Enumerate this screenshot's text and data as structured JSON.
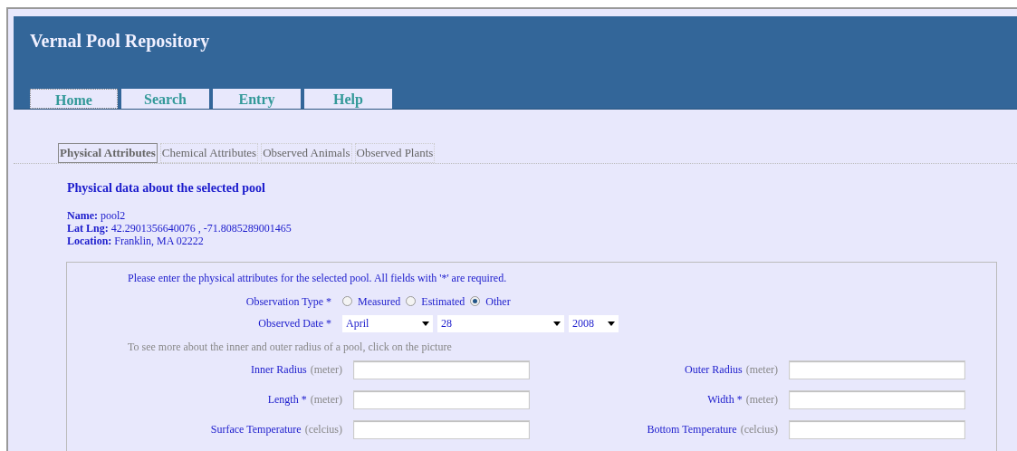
{
  "site_title": "Vernal Pool Repository",
  "nav": [
    {
      "label": "Home",
      "selected": true
    },
    {
      "label": "Search",
      "selected": false
    },
    {
      "label": "Entry",
      "selected": false
    },
    {
      "label": "Help",
      "selected": false
    }
  ],
  "tabs": [
    {
      "label": "Physical Attributes",
      "selected": true
    },
    {
      "label": "Chemical Attributes",
      "selected": false
    },
    {
      "label": "Observed Animals",
      "selected": false
    },
    {
      "label": "Observed Plants",
      "selected": false
    }
  ],
  "heading": "Physical data about the selected pool",
  "info": [
    {
      "label": "Name:",
      "value": "pool2"
    },
    {
      "label": "Lat Lng:",
      "value": "42.2901356640076 , -71.8085289001465"
    },
    {
      "label": "Location:",
      "value": "Franklin, MA 02222"
    }
  ],
  "form": {
    "intro": "Please enter the physical attributes for the selected pool. All fields with '*' are required.",
    "observation_type": {
      "label": "Observation Type *",
      "options": [
        {
          "label": "Measured",
          "selected": false
        },
        {
          "label": "Estimated",
          "selected": false
        },
        {
          "label": "Other",
          "selected": true
        }
      ]
    },
    "observed_date": {
      "label": "Observed Date *",
      "selects": [
        {
          "value": "April"
        },
        {
          "value": "28"
        },
        {
          "value": "2008"
        }
      ]
    },
    "hint": "To see more about the inner and outer radius of a pool, click on the picture",
    "rows": [
      {
        "left": {
          "label": "Inner Radius",
          "unit": "(meter)"
        },
        "right": {
          "label": "Outer Radius",
          "unit": "(meter)"
        }
      },
      {
        "left": {
          "label": "Length *",
          "unit": "(meter)"
        },
        "right": {
          "label": "Width *",
          "unit": "(meter)"
        }
      },
      {
        "left": {
          "label": "Surface Temperature",
          "unit": "(celcius)"
        },
        "right": {
          "label": "Bottom Temperature",
          "unit": "(celcius)"
        }
      }
    ]
  }
}
